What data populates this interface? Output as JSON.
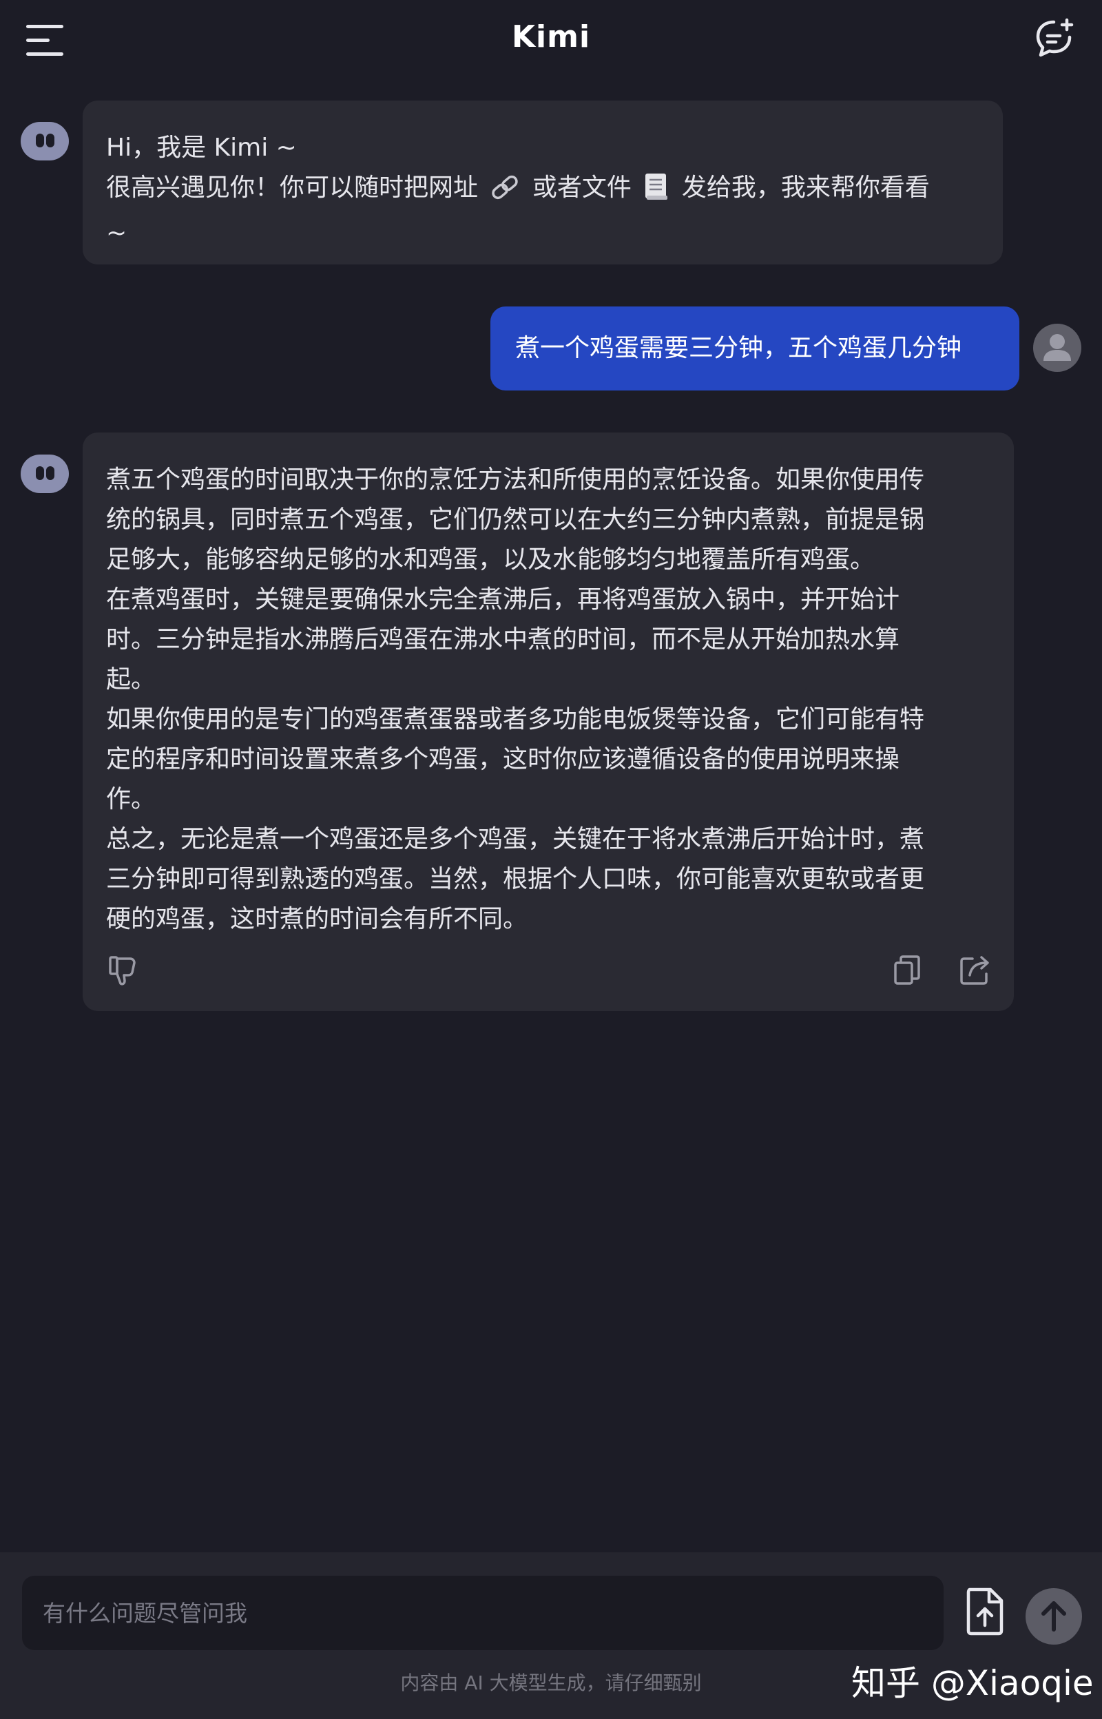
{
  "header": {
    "title": "Kimi",
    "menu_icon": "hamburger-menu-icon",
    "new_chat_icon": "new-chat-icon"
  },
  "messages": {
    "greeting": {
      "lines": [
        "Hi，我是 Kimi ~",
        "很高兴遇见你！你可以随时把网址",
        "或者文件",
        "发给我，我来帮你看看",
        "~"
      ],
      "link_icon": "link-icon",
      "file_icon": "document-icon"
    },
    "user_question": "煮一个鸡蛋需要三分钟，五个鸡蛋几分钟",
    "answer": {
      "lines": [
        "煮五个鸡蛋的时间取决于你的烹饪方法和所使用的烹饪设备。如果你使用传",
        "统的锅具，同时煮五个鸡蛋，它们仍然可以在大约三分钟内煮熟，前提是锅",
        "足够大，能够容纳足够的水和鸡蛋，以及水能够均匀地覆盖所有鸡蛋。",
        "在煮鸡蛋时，关键是要确保水完全煮沸后，再将鸡蛋放入锅中，并开始计",
        "时。三分钟是指水沸腾后鸡蛋在沸水中煮的时间，而不是从开始加热水算",
        "起。",
        "如果你使用的是专门的鸡蛋煮蛋器或者多功能电饭煲等设备，它们可能有特",
        "定的程序和时间设置来煮多个鸡蛋，这时你应该遵循设备的使用说明来操",
        "作。",
        "总之，无论是煮一个鸡蛋还是多个鸡蛋，关键在于将水煮沸后开始计时，煮",
        "三分钟即可得到熟透的鸡蛋。当然，根据个人口味，你可能喜欢更软或者更",
        "硬的鸡蛋，这时煮的时间会有所不同。"
      ],
      "actions": [
        "thumbs-down-icon",
        "copy-icon",
        "share-icon"
      ]
    }
  },
  "composer": {
    "placeholder": "有什么问题尽管问我",
    "upload_icon": "file-upload-icon",
    "send_icon": "send-arrow-icon",
    "disclaimer": "内容由 AI 大模型生成，请仔细甄别"
  },
  "watermark": "知乎 @Xiaoqie",
  "colors": {
    "background": "#1c1c26",
    "bot_bubble": "#2a2a33",
    "user_bubble": "#2547c2",
    "bot_avatar": "#8b8fb0",
    "composer_bar": "#25252e"
  }
}
